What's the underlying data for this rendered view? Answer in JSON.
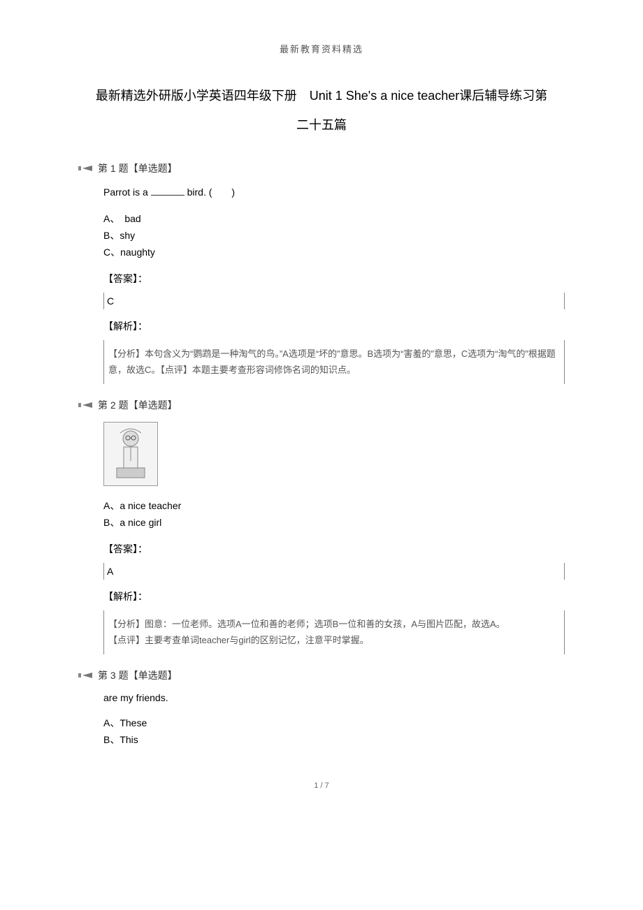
{
  "header": "最新教育资料精选",
  "title_line1": "最新精选外研版小学英语四年级下册　Unit 1 She's a nice teacher课后辅导练习第",
  "title_line2": "二十五篇",
  "q1": {
    "header": "第 1 题【单选题】",
    "stem_pre": "Parrot is a ",
    "stem_post": " bird. (　　)",
    "optA": "A、　bad",
    "optB": "B、shy",
    "optC": "C、naughty",
    "answer_label": "【答案】：",
    "answer": "C",
    "analysis_label": "【解析】：",
    "analysis": "【分析】本句含义为“鹦鹉是一种淘气的鸟。”A选项是“坏的”意思。B选项为“害羞的”意思，C选项为“淘气的”根据题意，故选C。【点评】本题主要考查形容词修饰名词的知识点。"
  },
  "q2": {
    "header": "第 2 题【单选题】",
    "image_alt": "teacher-illustration",
    "optA": "A、a nice teacher",
    "optB": "B、a nice girl",
    "answer_label": "【答案】：",
    "answer": "A",
    "analysis_label": "【解析】：",
    "analysis_line1": "【分析】图意：一位老师。选项A一位和善的老师；选项B一位和善的女孩，A与图片匹配，故选A。",
    "analysis_line2": "【点评】主要考查单词teacher与girl的区别记忆，注意平时掌握。"
  },
  "q3": {
    "header": "第 3 题【单选题】",
    "stem": "are my friends.",
    "optA": "A、These",
    "optB": "B、This"
  },
  "footer": "1 / 7"
}
